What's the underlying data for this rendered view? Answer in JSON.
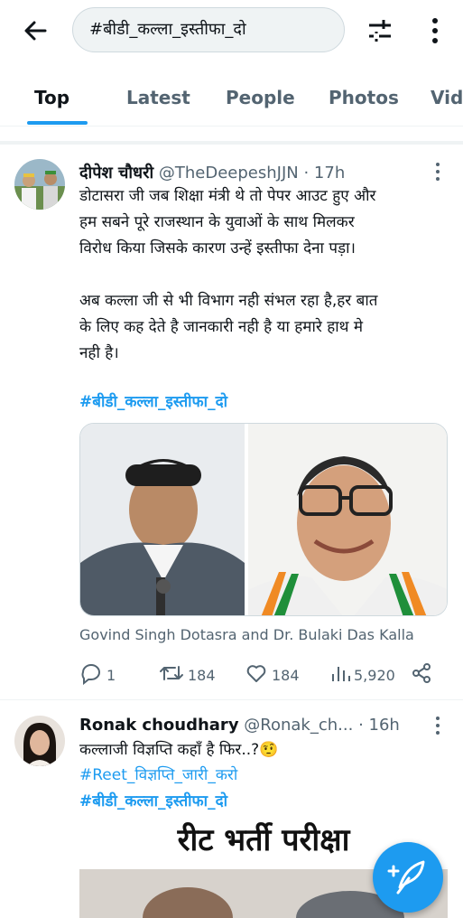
{
  "search": {
    "query": "#बीडी_कल्ला_इस्तीफा_दो"
  },
  "tabs": [
    {
      "label": "Top"
    },
    {
      "label": "Latest"
    },
    {
      "label": "People"
    },
    {
      "label": "Photos"
    },
    {
      "label": "Vid"
    }
  ],
  "tweets": [
    {
      "name": "दीपेश चौधरी",
      "handle": "@TheDeepeshJJN",
      "time": "· 17h",
      "text": "डोटासरा जी जब शिक्षा मंत्री थे तो पेपर आउट हुए और\nहम सबने पूरे राजस्थान के युवाओं के साथ मिलकर\nविरोध किया जिसके कारण उन्हें इस्तीफा देना पड़ा।\n\nअब कल्ला जी से भी विभाग नही संभल रहा है,हर बात\nके लिए कह देते है जानकारी नही है या हमारे हाथ मे\nनही है।",
      "hashtag": "#बीडी_कल्ला_इस्तीफा_दो",
      "media_caption": "Govind Singh Dotasra and Dr. Bulaki Das Kalla",
      "replies": "1",
      "retweets": "184",
      "likes": "184",
      "views": "5,920"
    },
    {
      "name": "Ronak choudhary",
      "handle": "@Ronak_ch...",
      "time": "· 16h",
      "text": "कल्लाजी विज्ञप्ति कहाँ है फिर..?🤨",
      "hashtag1": "#Reet_विज्ञप्ति_जारी_करो",
      "hashtag2": "#बीडी_कल्ला_इस्तीफा_दो",
      "image_text": "रीट भर्ती परीक्षा"
    }
  ],
  "colors": {
    "accent": "#1d9bf0",
    "text": "#0f1419",
    "secondary": "#536471"
  }
}
